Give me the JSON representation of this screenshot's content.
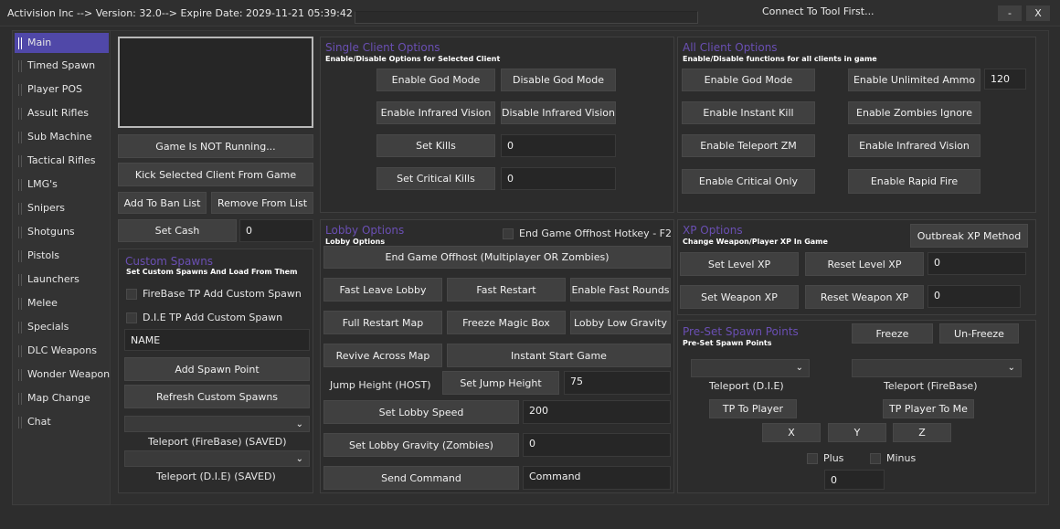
{
  "titlebar": {
    "title": "Activision Inc --> Version: 32.0--> Expire Date: 2029-11-21 05:39:42",
    "connect_status": "Connect To Tool First...",
    "minimize": "-",
    "close": "X"
  },
  "sidebar": {
    "items": [
      {
        "label": "Main",
        "active": true
      },
      {
        "label": "Timed Spawn"
      },
      {
        "label": "Player POS"
      },
      {
        "label": "Assult Rifles"
      },
      {
        "label": "Sub Machine"
      },
      {
        "label": "Tactical Rifles"
      },
      {
        "label": "LMG's"
      },
      {
        "label": "Snipers"
      },
      {
        "label": "Shotguns"
      },
      {
        "label": "Pistols"
      },
      {
        "label": "Launchers"
      },
      {
        "label": "Melee"
      },
      {
        "label": "Specials"
      },
      {
        "label": "DLC Weapons"
      },
      {
        "label": "Wonder Weapons"
      },
      {
        "label": "Map Change"
      },
      {
        "label": "Chat"
      }
    ]
  },
  "left": {
    "game_status": "Game Is NOT Running...",
    "kick_client": "Kick Selected Client From Game",
    "add_ban": "Add To Ban List",
    "remove_list": "Remove From List",
    "set_cash": "Set Cash",
    "cash_value": "0",
    "custom_spawns_title": "Custom Spawns",
    "custom_spawns_sub": "Set Custom Spawns And Load From Them",
    "firebase_tp_label": "FireBase TP Add Custom Spawn",
    "die_tp_label": "D.I.E TP Add Custom Spawn",
    "name_value": "NAME",
    "add_spawn": "Add Spawn Point",
    "refresh_spawns": "Refresh Custom Spawns",
    "teleport_firebase_saved": "Teleport (FireBase) (SAVED)",
    "teleport_die_saved": "Teleport (D.I.E) (SAVED)"
  },
  "single_client": {
    "title": "Single Client Options",
    "subtitle": "Enable/Disable Options for Selected Client",
    "enable_god": "Enable God Mode",
    "disable_god": "Disable God Mode",
    "enable_infrared": "Enable Infrared Vision",
    "disable_infrared": "Disable Infrared Vision",
    "set_kills": "Set Kills",
    "kills_value": "0",
    "set_critical_kills": "Set Critical Kills",
    "critical_kills_value": "0"
  },
  "all_client": {
    "title": "All Client Options",
    "subtitle": "Enable/Disable functions for all clients in game",
    "enable_god": "Enable God Mode",
    "enable_unlimited_ammo": "Enable Unlimited Ammo",
    "ammo_value": "120",
    "enable_instant_kill": "Enable Instant Kill",
    "enable_zombies_ignore": "Enable Zombies Ignore",
    "enable_teleport_zm": "Enable Teleport ZM",
    "enable_infrared": "Enable Infrared Vision",
    "enable_critical_only": "Enable Critical Only",
    "enable_rapid_fire": "Enable Rapid Fire"
  },
  "lobby": {
    "title": "Lobby Options",
    "subtitle": "Lobby Options",
    "end_game_hotkey": "End Game Offhost Hotkey - F2",
    "end_game_offhost": "End Game Offhost (Multiplayer OR Zombies)",
    "fast_leave": "Fast Leave Lobby",
    "fast_restart": "Fast Restart",
    "enable_fast_rounds": "Enable Fast Rounds",
    "full_restart": "Full Restart Map",
    "freeze_magic_box": "Freeze Magic Box",
    "lobby_low_gravity": "Lobby Low Gravity",
    "revive_across_map": "Revive Across Map",
    "instant_start": "Instant Start Game",
    "jump_height_label": "Jump Height (HOST)",
    "set_jump_height": "Set Jump Height",
    "jump_value": "75",
    "set_lobby_speed": "Set Lobby Speed",
    "speed_value": "200",
    "set_lobby_gravity": "Set Lobby Gravity (Zombies)",
    "gravity_value": "0",
    "send_command": "Send Command",
    "command_value": "Command"
  },
  "xp": {
    "title": "XP Options",
    "subtitle": "Change Weapon/Player XP In Game",
    "outbreak_xp": "Outbreak XP Method",
    "set_level_xp": "Set Level XP",
    "reset_level_xp": "Reset Level XP",
    "level_xp_value": "0",
    "set_weapon_xp": "Set Weapon XP",
    "reset_weapon_xp": "Reset Weapon XP",
    "weapon_xp_value": "0"
  },
  "preset_spawns": {
    "title": "Pre-Set Spawn Points",
    "subtitle": "Pre-Set Spawn Points",
    "freeze": "Freeze",
    "unfreeze": "Un-Freeze",
    "teleport_die": "Teleport (D.I.E)",
    "teleport_firebase": "Teleport (FireBase)",
    "tp_to_player": "TP To Player",
    "tp_player_to_me": "TP Player To Me",
    "x": "X",
    "y": "Y",
    "z": "Z",
    "plus": "Plus",
    "minus": "Minus",
    "step_value": "0"
  },
  "colors": {
    "accent": "#5048a8",
    "panel_title": "#6a4fb3",
    "background": "#2d2d2d",
    "button": "#404040"
  }
}
